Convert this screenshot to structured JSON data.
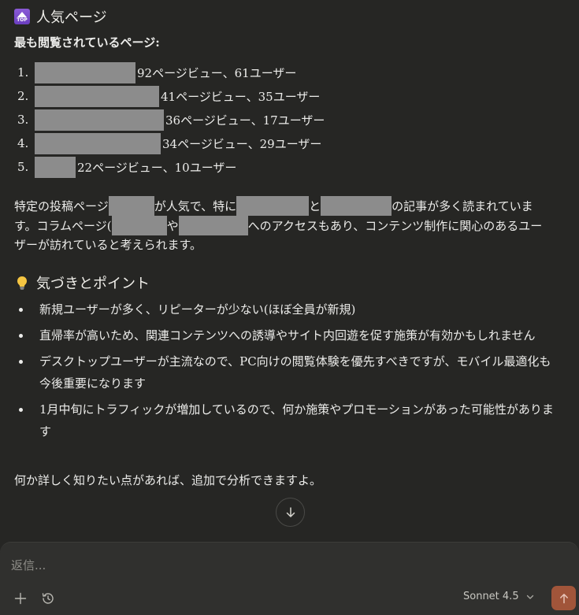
{
  "top_pages": {
    "heading": "人気ページ",
    "icon_label": "TOP",
    "subheading": "最も閲覧されているページ:",
    "items": [
      {
        "num": "1.",
        "stats": "92ページビュー、61ユーザー"
      },
      {
        "num": "2.",
        "stats": "41ページビュー、35ユーザー"
      },
      {
        "num": "3.",
        "stats": "36ページビュー、17ユーザー"
      },
      {
        "num": "4.",
        "stats": "34ページビュー、29ユーザー"
      },
      {
        "num": "5.",
        "stats": "22ページビュー、10ユーザー"
      }
    ],
    "paragraph": {
      "p1": "特定の投稿ページ",
      "p2": "が人気で、特に",
      "p3": "と",
      "p4": "の記事が多く読まれています。コラムページ(",
      "p5": "や",
      "p6": "へのアクセスもあり、コンテンツ制作に関心のあるユーザーが訪れていると考えられます。"
    }
  },
  "insights": {
    "heading": "気づきとポイント",
    "items": [
      "新規ユーザーが多く、リピーターが少ない(ほぼ全員が新規)",
      "直帰率が高いため、関連コンテンツへの誘導やサイト内回遊を促す施策が有効かもしれません",
      "デスクトップユーザーが主流なので、PC向けの閲覧体験を優先すべきですが、モバイル最適化も今後重要になります",
      "1月中旬にトラフィックが増加しているので、何か施策やプロモーションがあった可能性があります"
    ]
  },
  "closing": "何か詳しく知りたい点があれば、追加で分析できますよ。",
  "composer": {
    "placeholder": "返信...",
    "model": "Sonnet 4.5"
  },
  "icons": {
    "top": "top-arrow-icon",
    "bulb": "lightbulb-icon",
    "scroll": "arrow-down-icon",
    "add": "plus-icon",
    "history": "clock-history-icon",
    "chevron": "chevron-down-icon",
    "send": "arrow-up-icon"
  },
  "colors": {
    "background": "#262624",
    "composer": "#30302e",
    "send": "#a1553a",
    "redaction": "#8c8c8c"
  }
}
